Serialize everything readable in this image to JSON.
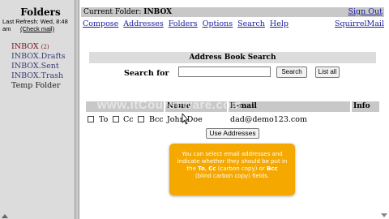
{
  "sidebar": {
    "title": "Folders",
    "last_refresh": "Last Refresh: Wed, 8:48 am",
    "check_mail": "(Check mail)",
    "folders": [
      {
        "label": "INBOX",
        "count": "(2)"
      },
      {
        "label": "INBOX.Drafts"
      },
      {
        "label": "INBOX.Sent"
      },
      {
        "label": "INBOX.Trash"
      },
      {
        "label": "Temp Folder"
      }
    ]
  },
  "topbar": {
    "current_folder_label": "Current Folder:",
    "current_folder": "INBOX",
    "sign_out": "Sign Out"
  },
  "nav": {
    "items": [
      "Compose",
      "Addresses",
      "Folders",
      "Options",
      "Search",
      "Help"
    ],
    "brand": "SquirrelMail"
  },
  "address_book": {
    "header": "Address Book Search",
    "search_label": "Search for",
    "search_value": "",
    "search_button": "Search",
    "list_all_button": "List all",
    "columns": {
      "name": "Name",
      "email": "E-mail",
      "info": "Info"
    },
    "watermark": "www.itCourseware.com",
    "rows": [
      {
        "to": "To",
        "cc": "Cc",
        "bcc": "Bcc",
        "name": "John Doe",
        "email": "dad@demo123.com"
      }
    ],
    "use_button": "Use Addresses"
  },
  "tooltip": {
    "line1": "You can select email addresses and",
    "line2": "indicate whether they should be put in",
    "line3_pre": "the ",
    "to": "To",
    "line3_mid": ", ",
    "cc": "Cc",
    "line3_post": " (carbon copy) or ",
    "bcc": "Bcc",
    "line4": "(blind carbon copy) fields."
  },
  "colors": {
    "tooltip_bg": "#f5a800",
    "link": "#1a1aa0",
    "active_folder": "#7a1020"
  }
}
